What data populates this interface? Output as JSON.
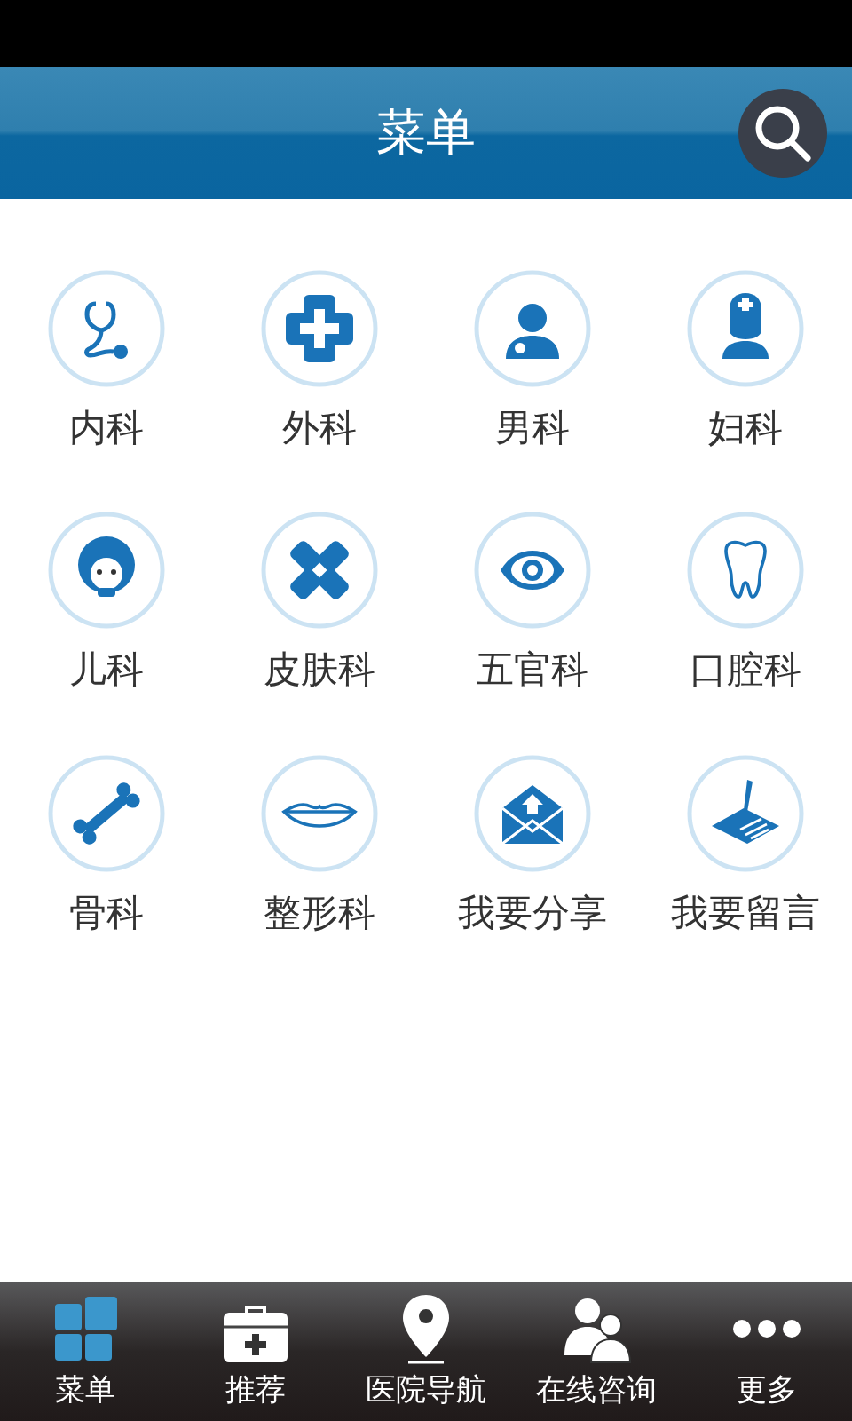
{
  "header": {
    "title": "菜单"
  },
  "departments": [
    {
      "label": "内科"
    },
    {
      "label": "外科"
    },
    {
      "label": "男科"
    },
    {
      "label": "妇科"
    },
    {
      "label": "儿科"
    },
    {
      "label": "皮肤科"
    },
    {
      "label": "五官科"
    },
    {
      "label": "口腔科"
    },
    {
      "label": "骨科"
    },
    {
      "label": "整形科"
    },
    {
      "label": "我要分享"
    },
    {
      "label": "我要留言"
    }
  ],
  "bottom_nav": [
    {
      "label": "菜单",
      "selected": true
    },
    {
      "label": "推荐",
      "selected": false
    },
    {
      "label": "医院导航",
      "selected": false
    },
    {
      "label": "在线咨询",
      "selected": false
    },
    {
      "label": "更多",
      "selected": false
    }
  ]
}
